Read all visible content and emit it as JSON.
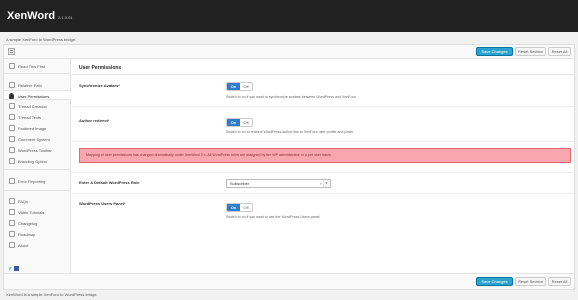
{
  "header": {
    "title": "XenWord",
    "version": "2.1.0.01"
  },
  "subtitle": "A simple XenForo to WordPress bridge.",
  "toolbar": {
    "save_label": "Save Changes",
    "reset_section_label": "Reset Section",
    "reset_all_label": "Reset All"
  },
  "sidebar": {
    "items": [
      {
        "label": "Read This First"
      },
      {
        "label": "Relative Path"
      },
      {
        "label": "User Permissions"
      },
      {
        "label": "Thread Creation"
      },
      {
        "label": "Thread Texts"
      },
      {
        "label": "Featured Image"
      },
      {
        "label": "Comment System"
      },
      {
        "label": "WordPress Toolbar"
      },
      {
        "label": "Branding Option"
      },
      {
        "label": "Error Reporting"
      },
      {
        "label": "FAQs"
      },
      {
        "label": "Video Tutorials"
      },
      {
        "label": "Changelog"
      },
      {
        "label": "Roadmap"
      },
      {
        "label": "About"
      }
    ]
  },
  "section": {
    "title": "User Permissions"
  },
  "options": {
    "sync_avatars": {
      "label": "Synchronize Avatars*",
      "on": "On",
      "off": "Off",
      "help": "Switch to on if you want to synchronize avatars between WordPress and XenForo."
    },
    "author_redirect": {
      "label": "Author redirect*",
      "on": "On",
      "off": "Off",
      "help": "Switch to on to redirect WordPress author link to XenForo user profile and posts."
    },
    "default_role": {
      "label": "Enter A Default WordPress Role",
      "value": "Subscriber",
      "clear": "×"
    },
    "users_panel": {
      "label": "WordPress Users Panel*",
      "on": "On",
      "off": "Off",
      "help": "Switch to on if you want to use the WordPress Users panel."
    }
  },
  "notice": "Mapping of user permissions has changed dramatically under XenWord 2.x. All WordPress roles are assigned by the WP administrator or a per user basis.",
  "footer": "XenWord is a simple XenForo to WordPress bridge.",
  "colors": {
    "primary": "#2ea2cc",
    "toggle_on": "#2e7bcf",
    "notice_bg": "#f7a7ad"
  }
}
